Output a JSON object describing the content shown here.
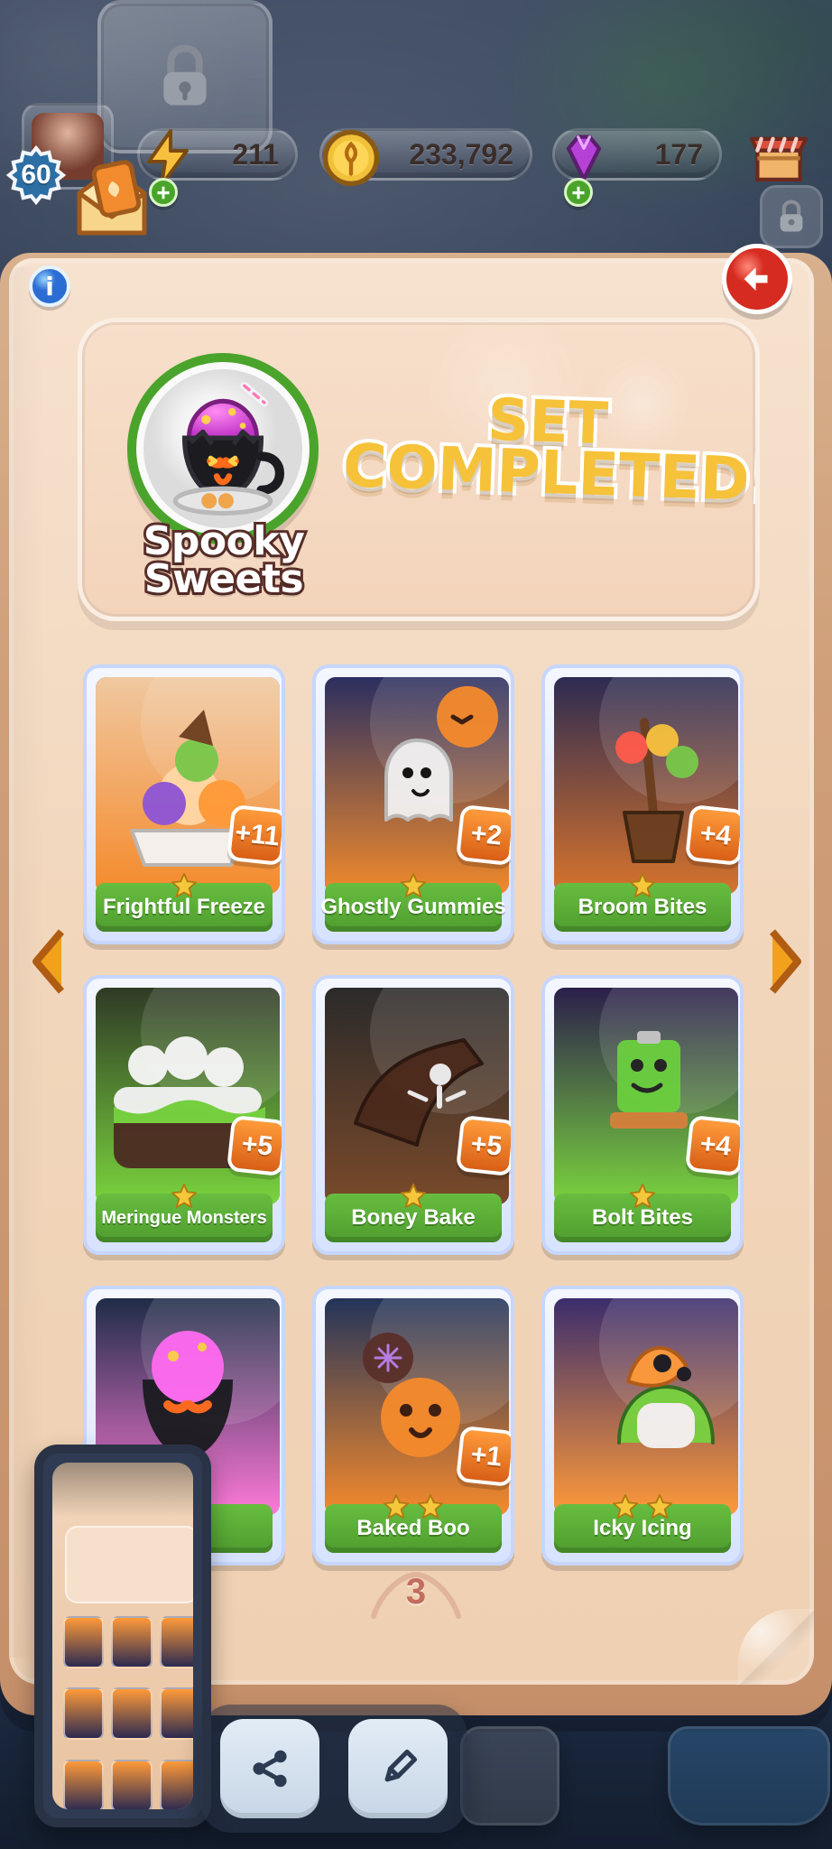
{
  "hud": {
    "level": "60",
    "energy": "211",
    "coins": "233,792",
    "gems": "177"
  },
  "book": {
    "set_name": "Spooky Sweets",
    "status_title": "SET COMPLETED!",
    "page_number": "3"
  },
  "cards": [
    {
      "title": "Frightful Freeze",
      "dup": "+11",
      "stars": 1,
      "theme": "freeze"
    },
    {
      "title": "Ghostly Gummies",
      "dup": "+2",
      "stars": 1,
      "theme": "ghost"
    },
    {
      "title": "Broom Bites",
      "dup": "+4",
      "stars": 1,
      "theme": "broom"
    },
    {
      "title": "Meringue Monsters",
      "dup": "+5",
      "stars": 1,
      "theme": "meringue"
    },
    {
      "title": "Boney Bake",
      "dup": "+5",
      "stars": 1,
      "theme": "boney"
    },
    {
      "title": "Bolt Bites",
      "dup": "+4",
      "stars": 1,
      "theme": "bolt"
    },
    {
      "title": "...up",
      "dup": "",
      "stars": 1,
      "theme": "cat"
    },
    {
      "title": "Baked Boo",
      "dup": "+1",
      "stars": 2,
      "theme": "boo"
    },
    {
      "title": "Icky Icing",
      "dup": "",
      "stars": 2,
      "theme": "icky"
    }
  ],
  "icons": {
    "lock": "lock-icon",
    "energy": "lightning-icon",
    "coin": "coin-icon",
    "gem": "gem-icon",
    "shop": "shop-icon",
    "info": "info-icon",
    "back": "back-arrow-icon",
    "share": "share-icon",
    "edit": "pencil-icon",
    "prev": "chevron-left-icon",
    "next": "chevron-right-icon"
  },
  "colors": {
    "accent_green": "#5fae3b",
    "accent_orange": "#f28b2d",
    "accent_red": "#d52b20"
  }
}
